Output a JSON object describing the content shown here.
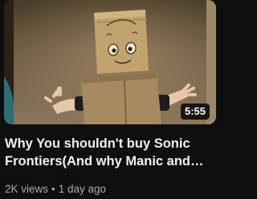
{
  "video": {
    "duration": "5:55",
    "title": "Why You shouldn't buy Sonic Frontiers(And why Manic and Sonia are Better)",
    "views": "2K views",
    "separator": "•",
    "age": "1 day ago"
  },
  "colors": {
    "background": "#0f0f0f",
    "title_text": "#f1f1f1",
    "meta_text": "#aaaaaa"
  }
}
